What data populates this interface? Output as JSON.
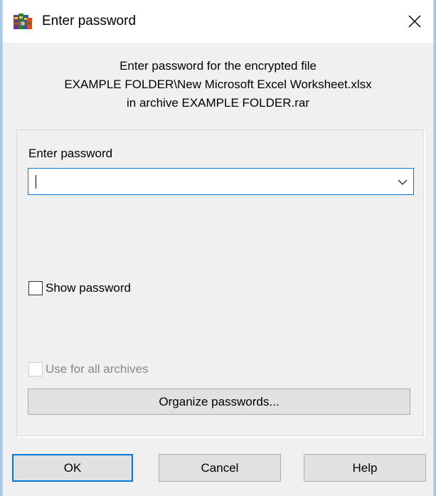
{
  "window": {
    "title": "Enter password",
    "app_icon": "winrar-books-icon",
    "close_icon": "close-icon"
  },
  "message": {
    "line1": "Enter password for the encrypted file",
    "line2": "EXAMPLE FOLDER\\New Microsoft Excel Worksheet.xlsx",
    "line3": "in archive EXAMPLE FOLDER.rar"
  },
  "password": {
    "label": "Enter password",
    "value": "",
    "placeholder": "",
    "dropdown_icon": "chevron-down-icon"
  },
  "options": {
    "show_password_label": "Show password",
    "show_password_checked": false,
    "use_for_all_label": "Use for all archives",
    "use_for_all_checked": false,
    "use_for_all_enabled": false
  },
  "buttons": {
    "organize": "Organize passwords...",
    "ok": "OK",
    "cancel": "Cancel",
    "help": "Help"
  },
  "colors": {
    "accent": "#0078d7",
    "dialog_bg": "#f0f0f0",
    "desktop_bg": "#aac6e8"
  }
}
